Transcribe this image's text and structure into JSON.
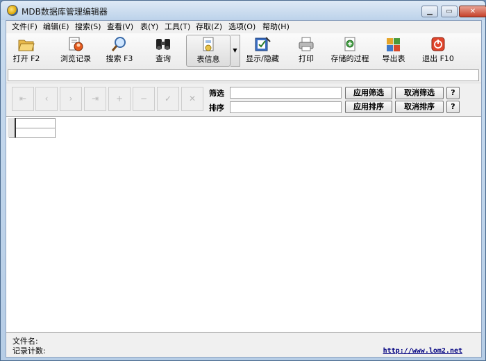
{
  "window": {
    "title": "MDB数据库管理编辑器"
  },
  "menu": [
    "文件(F)",
    "编辑(E)",
    "搜索(S)",
    "查看(V)",
    "表(Y)",
    "工具(T)",
    "存取(Z)",
    "选项(O)",
    "帮助(H)"
  ],
  "toolbar": [
    {
      "label": "打开 F2",
      "icon": "folder-open-icon"
    },
    {
      "label": "浏览记录",
      "icon": "browse-records-icon"
    },
    {
      "label": "搜索 F3",
      "icon": "magnifier-icon"
    },
    {
      "label": "查询",
      "icon": "binoculars-icon"
    },
    {
      "label": "表信息",
      "icon": "table-info-icon"
    },
    {
      "label": "显示/隐藏",
      "icon": "show-hide-icon"
    },
    {
      "label": "打印",
      "icon": "printer-icon"
    },
    {
      "label": "存储的过程",
      "icon": "stored-procedure-icon"
    },
    {
      "label": "导出表",
      "icon": "export-table-icon"
    },
    {
      "label": "退出 F10",
      "icon": "power-icon"
    }
  ],
  "filter": {
    "filter_label": "筛选",
    "sort_label": "排序",
    "apply_filter": "应用筛选",
    "cancel_filter": "取消筛选",
    "apply_sort": "应用排序",
    "cancel_sort": "取消排序",
    "help": "?"
  },
  "status": {
    "filename_label": "文件名:",
    "record_count_label": "记录计数:",
    "url": "http://www.lom2.net"
  },
  "colors": {
    "title_bar": "#bcd2ea",
    "close_button": "#c6412b",
    "link": "#000080"
  }
}
